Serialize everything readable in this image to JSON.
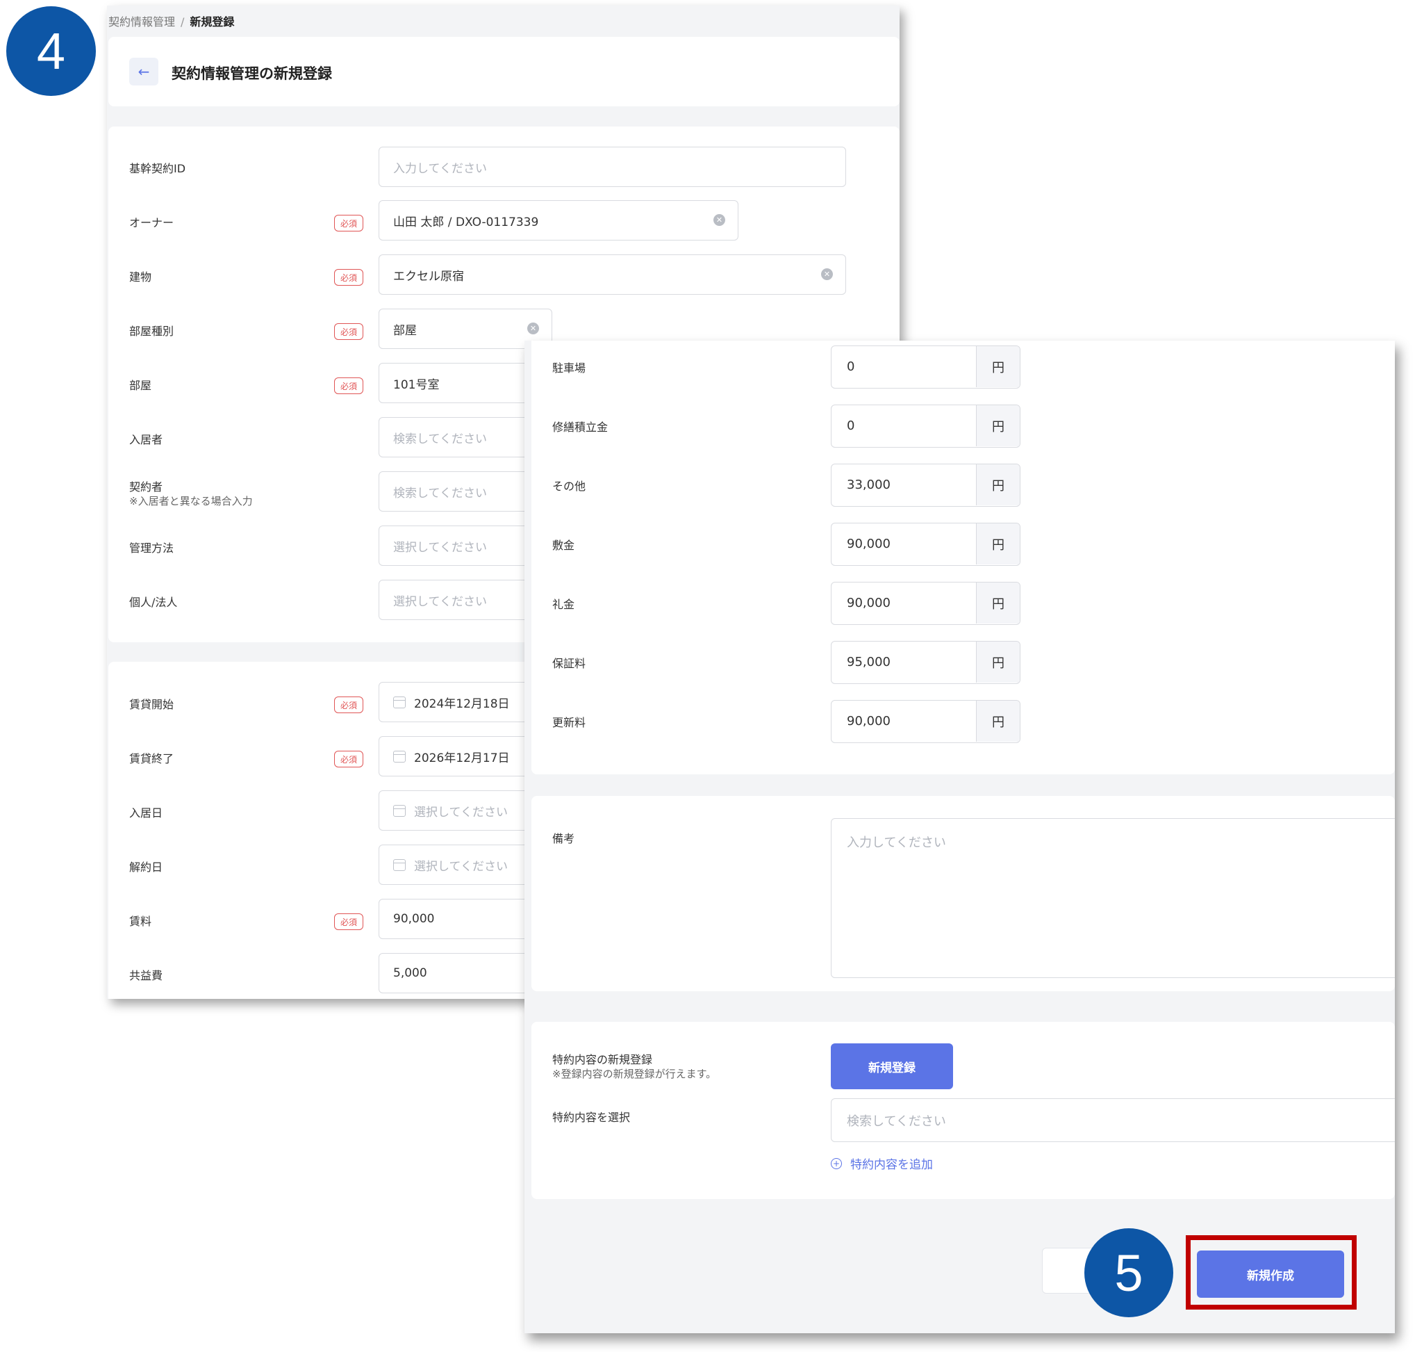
{
  "step_badges": {
    "first": "4",
    "second": "5"
  },
  "colors": {
    "accent": "#5b74e6",
    "required": "#e05555",
    "badge": "#0d56a6",
    "highlight": "#c00000"
  },
  "back_screen": {
    "breadcrumb": {
      "parent": "契約情報管理",
      "separator": "/",
      "current": "新規登録"
    },
    "header": {
      "back_icon": "arrow-left-icon",
      "back_glyph": "←",
      "title": "契約情報管理の新規登録"
    },
    "required_label": "必須",
    "fields": {
      "base_contract_id": {
        "label": "基幹契約ID",
        "placeholder": "入力してください"
      },
      "owner": {
        "label": "オーナー",
        "value": "山田 太郎 / DXO-0117339"
      },
      "building": {
        "label": "建物",
        "value": "エクセル原宿"
      },
      "room_type": {
        "label": "部屋種別",
        "value": "部屋"
      },
      "room": {
        "label": "部屋",
        "value": "101号室"
      },
      "resident": {
        "label": "入居者",
        "placeholder": "検索してください"
      },
      "contractor": {
        "label": "契約者",
        "note": "※入居者と異なる場合入力",
        "placeholder": "検索してください"
      },
      "management": {
        "label": "管理方法",
        "placeholder": "選択してください"
      },
      "person_type": {
        "label": "個人/法人",
        "placeholder": "選択してください"
      },
      "lease_start": {
        "label": "賃貸開始",
        "value": "2024年12月18日"
      },
      "lease_end": {
        "label": "賃貸終了",
        "value": "2026年12月17日"
      },
      "move_in": {
        "label": "入居日",
        "placeholder": "選択してください"
      },
      "cancel_date": {
        "label": "解約日",
        "placeholder": "選択してください"
      },
      "rent": {
        "label": "賃料",
        "value": "90,000"
      },
      "common_fee": {
        "label": "共益費",
        "value": "5,000"
      }
    }
  },
  "front_screen": {
    "currency": "円",
    "fees": [
      {
        "label": "駐車場",
        "value": "0"
      },
      {
        "label": "修繕積立金",
        "value": "0"
      },
      {
        "label": "その他",
        "value": "33,000"
      },
      {
        "label": "敷金",
        "value": "90,000"
      },
      {
        "label": "礼金",
        "value": "90,000"
      },
      {
        "label": "保証料",
        "value": "95,000"
      },
      {
        "label": "更新料",
        "value": "90,000"
      }
    ],
    "remarks": {
      "label": "備考",
      "placeholder": "入力してください"
    },
    "special": {
      "label": "特約内容の新規登録",
      "note": "※登録内容の新規登録が行えます。",
      "register_button": "新規登録",
      "select_label": "特約内容を選択",
      "select_placeholder": "検索してください",
      "add_link": "特約内容を追加",
      "add_icon": "plus-circle-icon"
    },
    "footer": {
      "create_button": "新規作成"
    }
  }
}
